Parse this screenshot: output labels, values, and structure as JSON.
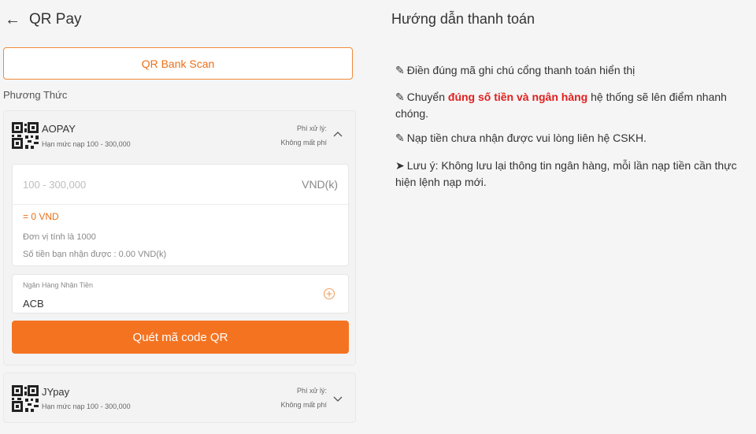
{
  "header": {
    "back_icon": "arrow-left-icon",
    "title": "QR Pay"
  },
  "tabs": [
    {
      "label": "QR Bank Scan"
    }
  ],
  "section_label": "Phương Thức",
  "methods": [
    {
      "name": "AOPAY",
      "limit": "Hạn mức nạp 100 - 300,000",
      "fee_label": "Phí xử lý:",
      "fee_value": "Không mất phí",
      "expanded": true,
      "amount_placeholder": "100 - 300,000",
      "amount_value": "",
      "amount_unit": "VND(k)",
      "converted": "= 0 VND",
      "unit_note": "Đơn vị tính là 1000",
      "receive_note": "Số tiền bạn nhận được : 0.00 VND(k)",
      "bank_label": "Ngân Hàng Nhận Tiền",
      "bank_value": "ACB",
      "scan_button": "Quét mã code QR"
    },
    {
      "name": "JYpay",
      "limit": "Hạn mức nạp 100 - 300,000",
      "fee_label": "Phí xử lý:",
      "fee_value": "Không mất phí",
      "expanded": false
    }
  ],
  "guide": {
    "title": "Hướng dẫn thanh toán",
    "items": [
      {
        "glyph": "✎",
        "text": "Điền đúng mã ghi chú cổng thanh toán hiển thị"
      },
      {
        "glyph": "✎",
        "prefix": "Chuyển ",
        "highlight": "đúng số tiền và ngân hàng",
        "suffix": " hệ thống sẽ lên điểm nhanh chóng."
      },
      {
        "glyph": "✎",
        "text": "Nạp tiền chưa nhận được vui lòng liên hệ CSKH."
      },
      {
        "glyph": "➤",
        "text": "Lưu ý: Không lưu lại thông tin ngân hàng, mỗi lần nạp tiền cần thực hiện lệnh nạp mới."
      }
    ]
  },
  "colors": {
    "accent": "#f47321",
    "highlight": "#e1201e",
    "background": "#f5f5f5"
  }
}
